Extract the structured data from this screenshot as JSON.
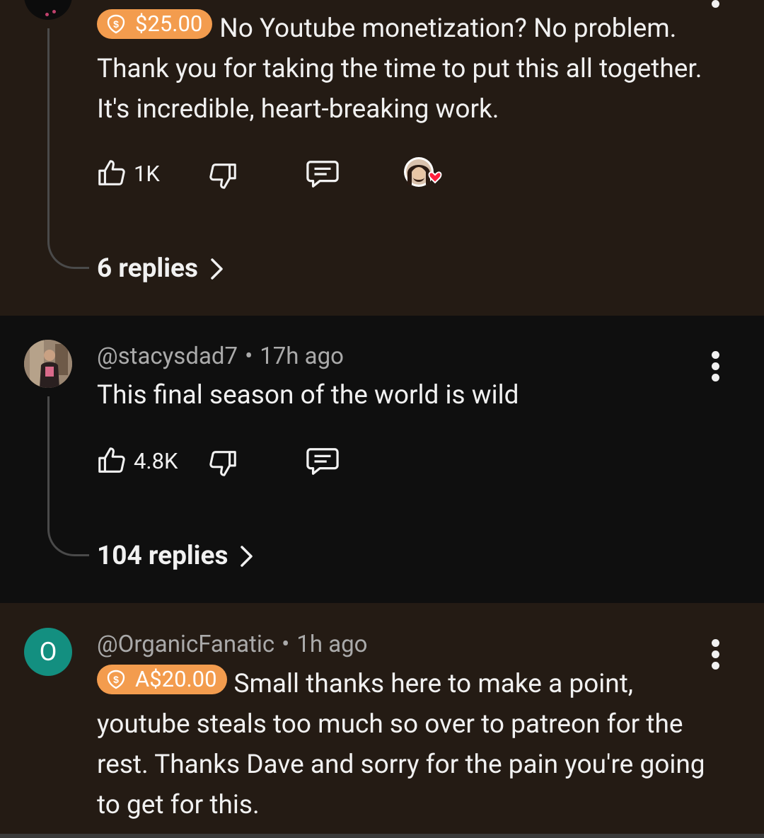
{
  "comments": [
    {
      "donation": "$25.00",
      "text": "No Youtube monetization? No problem. Thank you for taking the time to put this all together. It's incredible, heart-breaking work.",
      "likes": "1K",
      "replies": "6 replies",
      "creator_hearted": true
    },
    {
      "author": "@stacysdad7",
      "time": "17h ago",
      "text": "This final season of the world is wild",
      "likes": "4.8K",
      "replies": "104 replies"
    },
    {
      "author": "@OrganicFanatic",
      "time": "1h ago",
      "avatar_letter": "O",
      "donation": "A$20.00",
      "text": "Small thanks here to make a point, youtube steals too much so over to patreon for the rest. Thanks Dave and sorry for the pain you're going to get for this."
    }
  ],
  "colors": {
    "highlight_bg": "#241b14",
    "page_bg": "#0f0f0f",
    "donation_badge": "#f39c4e",
    "avatar_o": "#138f80",
    "heart": "#ff1f3d"
  },
  "icons": [
    "like-icon",
    "dislike-icon",
    "reply-icon",
    "creator-heart-icon",
    "chevron-right-icon",
    "more-vert-icon",
    "super-thanks-icon"
  ]
}
